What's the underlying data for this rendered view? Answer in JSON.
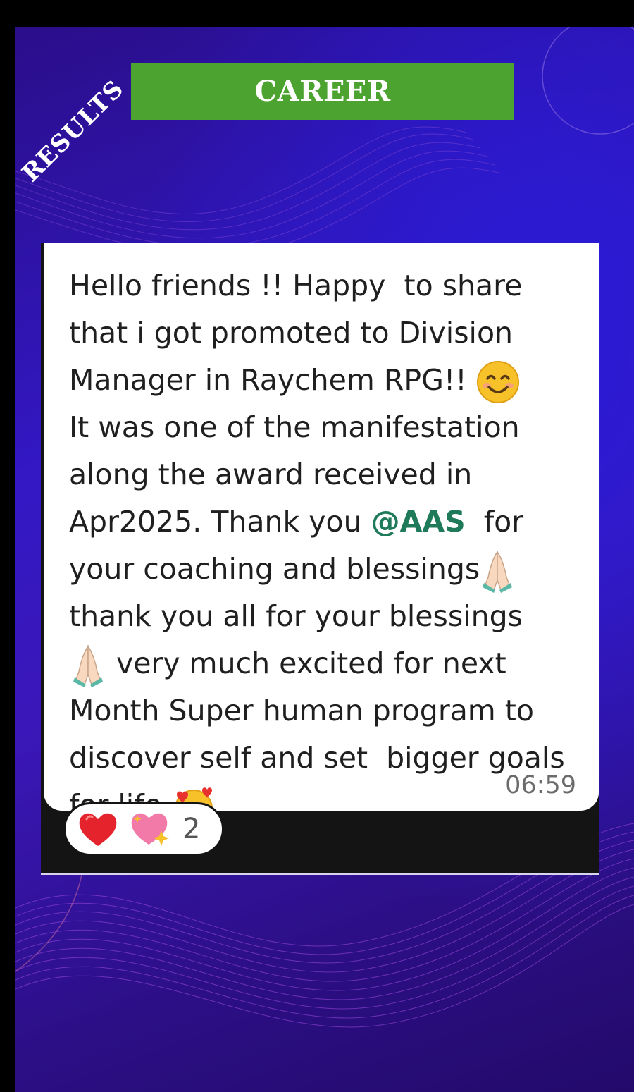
{
  "ribbon": {
    "label": "Results"
  },
  "header": {
    "title": "CAREER"
  },
  "message": {
    "lines": [
      "Hello friends !! Happy  to share",
      "that i got promoted to Division",
      "Manager in Raychem RPG!!",
      "It was one of the manifestation",
      "along the award received in",
      "Apr2025. Thank you ",
      "your coaching and blessings",
      "thank you all for your blessings",
      " very much excited for next",
      "Month Super human program to",
      "discover self and set  bigger goals",
      "for life"
    ],
    "mention": "@AAS",
    "after_mention": "  for",
    "timestamp": "06:59"
  },
  "reactions": {
    "count": "2"
  },
  "icons": {
    "smile": "smiling-face-icon",
    "pray": "folded-hands-icon",
    "love": "smiling-face-with-hearts-icon",
    "heart": "red-heart-icon",
    "sparkle": "sparkling-heart-icon"
  },
  "colors": {
    "career_bar": "#4ca32f",
    "mention": "#1f7a5a",
    "background": "#3318c4"
  }
}
